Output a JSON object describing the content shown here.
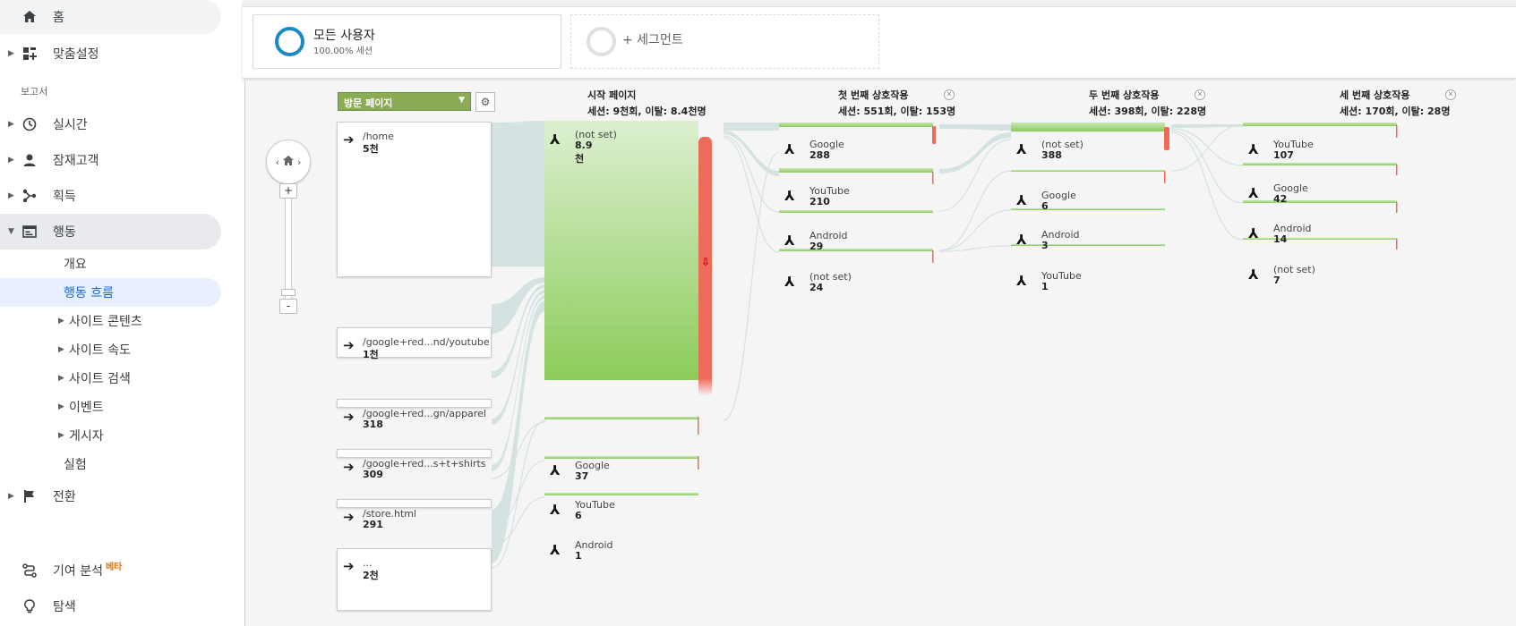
{
  "sidebar": {
    "home": "홈",
    "customization": "맞춤설정",
    "reports_label": "보고서",
    "realtime": "실시간",
    "audience": "잠재고객",
    "acquisition": "획득",
    "behavior": "행동",
    "behavior_sub": [
      "개요",
      "행동 흐름",
      "사이트 콘텐츠",
      "사이트 속도",
      "사이트 검색",
      "이벤트",
      "게시자",
      "실험"
    ],
    "conversions": "전환",
    "attribution": "기여 분석",
    "attribution_badge": "베타",
    "discover": "탐색"
  },
  "segments": {
    "all_users_title": "모든 사용자",
    "all_users_sub": "100.00% 세션",
    "add_segment": "+ 세그먼트"
  },
  "flow": {
    "dropdown_label": "방문 페이지",
    "columns": [
      {
        "title": "시작 페이지",
        "stats": "세션: 9천회, 이탈: 8.4천명"
      },
      {
        "title": "첫 번째 상호작용",
        "stats": "세션: 551회, 이탈: 153명"
      },
      {
        "title": "두 번째 상호작용",
        "stats": "세션: 398회, 이탈: 228명"
      },
      {
        "title": "세 번째 상호작용",
        "stats": "세션: 170회, 이탈: 28명"
      }
    ],
    "landing_pages": [
      {
        "name": "/home",
        "value": "5천"
      },
      {
        "name": "/google+red...nd/youtube",
        "value": "1천"
      },
      {
        "name": "/google+red...gn/apparel",
        "value": "318"
      },
      {
        "name": "/google+red...s+t+shirts",
        "value": "309"
      },
      {
        "name": "/store.html",
        "value": "291"
      },
      {
        "name": "...",
        "value": "2천"
      }
    ],
    "starting": [
      {
        "name": "(not set)",
        "value": "8.9천"
      },
      {
        "name": "Google",
        "value": "37"
      },
      {
        "name": "YouTube",
        "value": "6"
      },
      {
        "name": "Android",
        "value": "1"
      }
    ],
    "first": [
      {
        "name": "Google",
        "value": "288"
      },
      {
        "name": "YouTube",
        "value": "210"
      },
      {
        "name": "Android",
        "value": "29"
      },
      {
        "name": "(not set)",
        "value": "24"
      }
    ],
    "second": [
      {
        "name": "(not set)",
        "value": "388"
      },
      {
        "name": "Google",
        "value": "6"
      },
      {
        "name": "Android",
        "value": "3"
      },
      {
        "name": "YouTube",
        "value": "1"
      }
    ],
    "third": [
      {
        "name": "YouTube",
        "value": "107"
      },
      {
        "name": "Google",
        "value": "42"
      },
      {
        "name": "Android",
        "value": "14"
      },
      {
        "name": "(not set)",
        "value": "7"
      }
    ],
    "zoom_in": "+",
    "zoom_out": "-"
  },
  "colors": {
    "node_green_top": "#dcefd0",
    "node_green_bottom": "#8ccc5a",
    "dropoff_red": "#ee6b5a",
    "link_fill": "#d5e2e2",
    "segment_ring": "#1a8ac6"
  }
}
